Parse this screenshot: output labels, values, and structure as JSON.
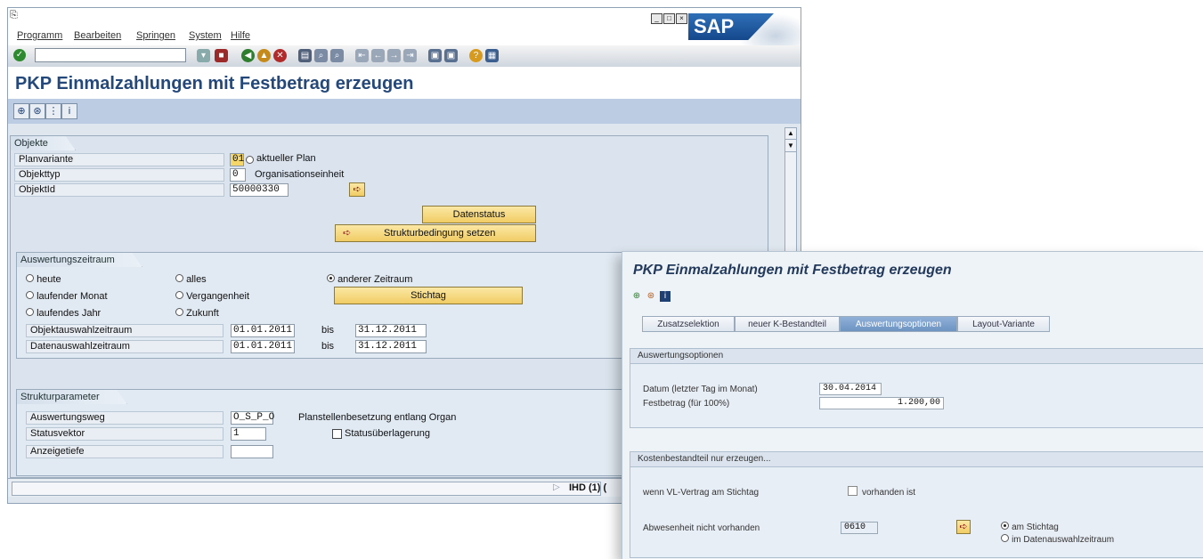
{
  "main": {
    "menu": [
      "Programm",
      "Bearbeiten",
      "Springen",
      "System",
      "Hilfe"
    ],
    "logo": "SAP",
    "title": "PKP Einmalzahlungen mit Festbetrag erzeugen",
    "objekte": {
      "tab": "Objekte",
      "planvariante_label": "Planvariante",
      "planvariante_value": "01",
      "planvariante_text": "aktueller Plan",
      "objekttyp_label": "Objekttyp",
      "objekttyp_value": "0",
      "objekttyp_text": "Organisationseinheit",
      "objektid_label": "ObjektId",
      "objektid_value": "50000330",
      "datenstatus_btn": "Datenstatus",
      "struktur_btn": "Strukturbedingung setzen"
    },
    "zeitraum": {
      "tab": "Auswertungszeitraum",
      "heute": "heute",
      "alles": "alles",
      "anderer": "anderer Zeitraum",
      "laufender_monat": "laufender Monat",
      "vergangenheit": "Vergangenheit",
      "stichtag_btn": "Stichtag",
      "laufendes_jahr": "laufendes Jahr",
      "zukunft": "Zukunft",
      "objektauswahl_label": "Objektauswahlzeitraum",
      "objektauswahl_from": "01.01.2011",
      "bis1": "bis",
      "objektauswahl_to": "31.12.2011",
      "datenauswahl_label": "Datenauswahlzeitraum",
      "datenauswahl_from": "01.01.2011",
      "bis2": "bis",
      "datenauswahl_to": "31.12.2011"
    },
    "struktur": {
      "tab": "Strukturparameter",
      "weg_label": "Auswertungsweg",
      "weg_value": "O_S_P_O",
      "weg_text": "Planstellenbesetzung entlang Organ",
      "status_label": "Statusvektor",
      "status_value": "1",
      "ueberlagerung": "Statusüberlagerung",
      "tiefe_label": "Anzeigetiefe",
      "tiefe_value": ""
    },
    "status_right": "IHD (1) ("
  },
  "overlay": {
    "title": "PKP Einmalzahlungen mit Festbetrag erzeugen",
    "tabs": [
      "Zusatzselektion",
      "neuer K-Bestandteil",
      "Auswertungsoptionen",
      "Layout-Variante"
    ],
    "options_head": "Auswertungsoptionen",
    "datum_label": "Datum (letzter Tag im Monat)",
    "datum_value": "30.04.2014",
    "fest_label": "Festbetrag (für 100%)",
    "fest_value": "1.200,00",
    "kosten_head": "Kostenbestandteil nur erzeugen...",
    "vertrag_label": "wenn VL-Vertrag am Stichtag",
    "vorhanden": "vorhanden ist",
    "abwesen_label": "Abwesenheit nicht vorhanden",
    "abwesen_value": "0610",
    "am_stichtag": "am Stichtag",
    "im_daten": "im Datenauswahlzeitraum"
  }
}
